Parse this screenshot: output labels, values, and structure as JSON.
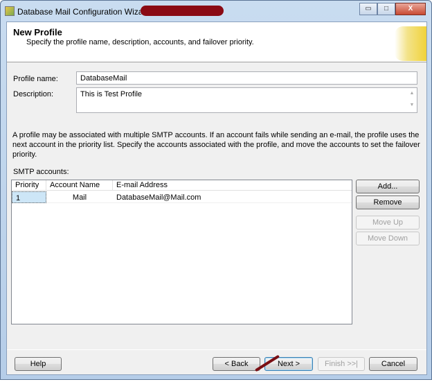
{
  "window": {
    "title": "Database Mail Configuration Wizard",
    "minimize": "▭",
    "maximize": "□",
    "close": "X"
  },
  "header": {
    "title": "New Profile",
    "subtitle": "Specify the profile name, description, accounts, and failover priority."
  },
  "form": {
    "profile_name_label": "Profile name:",
    "profile_name_value": "DatabaseMail",
    "description_label": "Description:",
    "description_value": "This is Test Profile"
  },
  "info_text": "A profile may be associated with multiple SMTP accounts. If an account fails while sending an e-mail, the profile uses the next account in the priority list. Specify the accounts associated with the profile, and move the accounts to set the failover priority.",
  "smtp": {
    "label": "SMTP accounts:",
    "columns": [
      "Priority",
      "Account Name",
      "E-mail Address"
    ],
    "rows": [
      {
        "priority": "1",
        "account_name": "Mail",
        "email": "DatabaseMail@Mail.com"
      }
    ]
  },
  "side_buttons": {
    "add": "Add...",
    "remove": "Remove",
    "move_up": "Move Up",
    "move_down": "Move Down"
  },
  "footer": {
    "help": "Help",
    "back": "< Back",
    "next": "Next >",
    "finish": "Finish >>|",
    "cancel": "Cancel"
  }
}
